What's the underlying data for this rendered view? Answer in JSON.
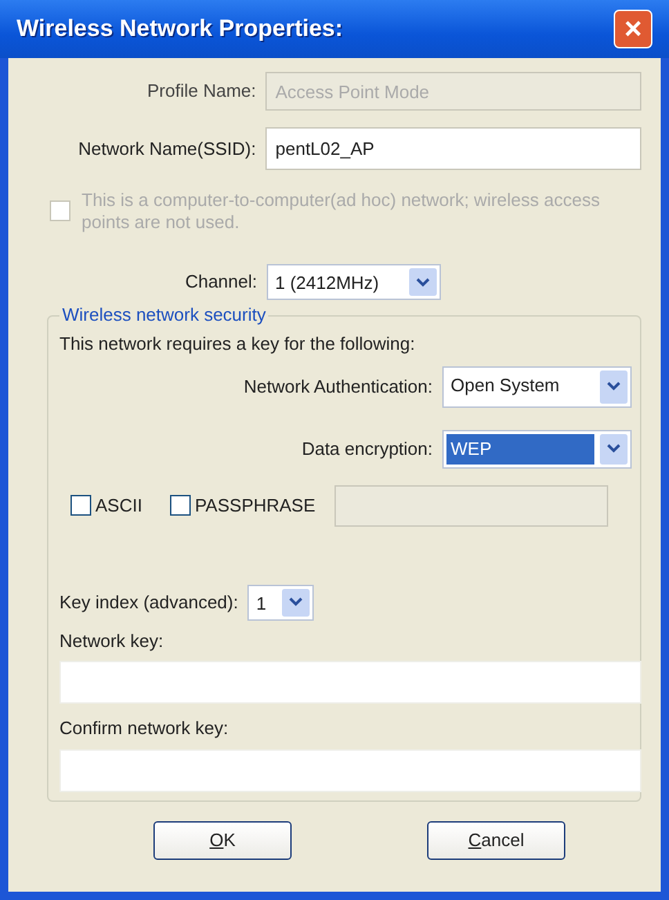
{
  "window": {
    "title": "Wireless Network Properties:",
    "close_button": "×"
  },
  "profile_name": {
    "label": "Profile Name:",
    "value": "Access Point Mode",
    "disabled": true
  },
  "network_name": {
    "label": "Network Name(SSID):",
    "value": "pentL02_AP",
    "disabled": false
  },
  "adhoc": {
    "label": "This is a computer-to-computer(ad hoc) network; wireless access points are not used.",
    "checked": false,
    "disabled": true
  },
  "channel": {
    "label": "Channel:",
    "value": "1  (2412MHz)",
    "focused": false
  },
  "security": {
    "legend": "Wireless network security",
    "intro": "This network requires a key for the following:",
    "authentication": {
      "label": "Network Authentication:",
      "value": "Open System",
      "focused": false
    },
    "encryption": {
      "label": "Data encryption:",
      "value": "WEP",
      "focused": true
    },
    "checkboxes": [
      {
        "label": "ASCII",
        "checked": false
      },
      {
        "label": "PASSPHRASE",
        "checked": false
      }
    ],
    "passphrase_field": {
      "disabled": true
    },
    "key_index": {
      "label": "Key index (advanced):",
      "value": "1",
      "focused": false
    },
    "network_key": {
      "label": "Network key:"
    },
    "confirm_key": {
      "label": "Confirm network key:"
    }
  },
  "buttons": [
    {
      "label": "OK",
      "mnemonic_underlined": true
    },
    {
      "label": "Cancel",
      "mnemonic_underlined": true
    }
  ]
}
